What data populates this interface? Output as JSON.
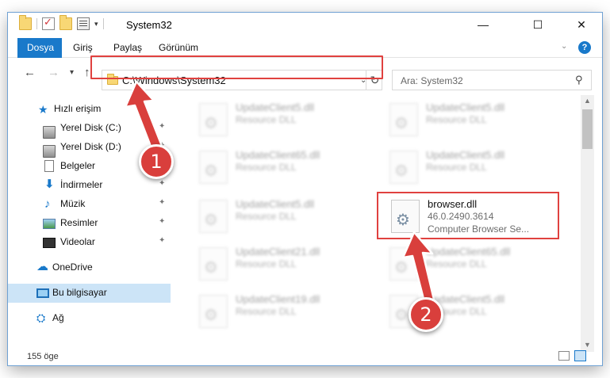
{
  "window": {
    "title": "System32"
  },
  "ribbon": {
    "tabs": [
      "Dosya",
      "Giriş",
      "Paylaş",
      "Görünüm"
    ],
    "help_label": "?"
  },
  "address": {
    "path": "C:\\Windows\\System32",
    "search_placeholder": "Ara: System32"
  },
  "sidebar": {
    "items": [
      {
        "label": "Hızlı erişim",
        "icon": "star-icon"
      },
      {
        "label": "Yerel Disk (C:)",
        "icon": "drive-icon",
        "pinned": true
      },
      {
        "label": "Yerel Disk (D:)",
        "icon": "drive-icon",
        "pinned": true
      },
      {
        "label": "Belgeler",
        "icon": "documents-icon",
        "pinned": true
      },
      {
        "label": "İndirmeler",
        "icon": "download-icon",
        "pinned": true
      },
      {
        "label": "Müzik",
        "icon": "music-icon",
        "pinned": true
      },
      {
        "label": "Resimler",
        "icon": "pictures-icon",
        "pinned": true
      },
      {
        "label": "Videolar",
        "icon": "videos-icon",
        "pinned": true
      },
      {
        "label": "OneDrive",
        "icon": "cloud-icon"
      },
      {
        "label": "Bu bilgisayar",
        "icon": "computer-icon",
        "selected": true
      },
      {
        "label": "Ağ",
        "icon": "network-icon"
      }
    ]
  },
  "files": [
    {
      "name": "UpdateClient5.dll",
      "type": "Resource DLL"
    },
    {
      "name": "UpdateClient5.dll",
      "type": "Resource DLL"
    },
    {
      "name": "UpdateClient65.dll",
      "type": "Resource DLL"
    },
    {
      "name": "UpdateClient5.dll",
      "type": "Resource DLL"
    },
    {
      "name": "UpdateClient5.dll",
      "type": "Resource DLL"
    },
    {
      "name": "browser.dll",
      "version": "46.0.2490.3614",
      "description": "Computer Browser Se..."
    },
    {
      "name": "UpdateClient21.dll",
      "type": "Resource DLL"
    },
    {
      "name": "UpdateClient65.dll",
      "type": "Resource DLL"
    },
    {
      "name": "UpdateClient19.dll",
      "type": "Resource DLL"
    },
    {
      "name": "UpdateClient5.dll",
      "type": "Resource DLL"
    }
  ],
  "status": {
    "item_count": "155 öge"
  },
  "annotations": {
    "step1": "1",
    "step2": "2"
  },
  "colors": {
    "accent": "#1979ca",
    "highlight": "#e0413f",
    "selected_bg": "#cce4f7"
  }
}
